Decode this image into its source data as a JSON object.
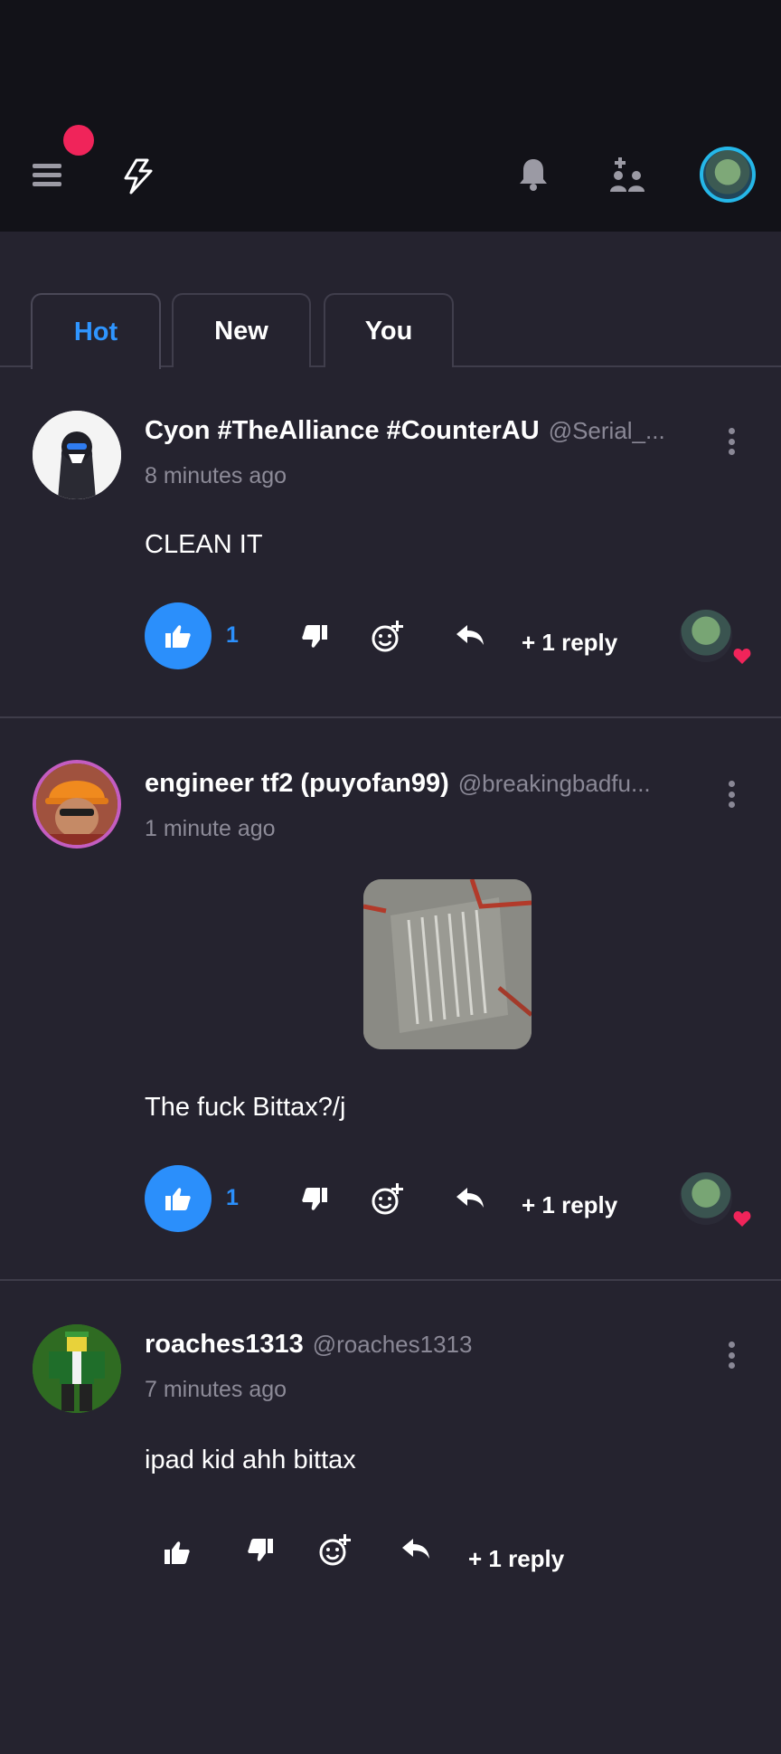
{
  "header": {
    "menu_icon": "hamburger-menu-icon",
    "logo_icon": "lightning-logo-icon",
    "bell_icon": "bell-icon",
    "friends_icon": "friends-add-icon",
    "notification_color": "#f0245a"
  },
  "tabs": [
    {
      "label": "Hot",
      "active": true
    },
    {
      "label": "New",
      "active": false
    },
    {
      "label": "You",
      "active": false
    }
  ],
  "comments": [
    {
      "display_name": "Cyon #TheAlliance #CounterAU",
      "handle": "@Serial_...",
      "time": "8 minutes ago",
      "text": "CLEAN IT",
      "likes": "1",
      "liked": true,
      "replies": "+ 1 reply",
      "has_reactor": true
    },
    {
      "display_name": "engineer tf2 (puyofan99)",
      "handle": "@breakingbadfu...",
      "time": "1 minute ago",
      "text": "The fuck Bittax?/j",
      "likes": "1",
      "liked": true,
      "replies": "+ 1 reply",
      "has_reactor": true,
      "has_image": true
    },
    {
      "display_name": "roaches1313",
      "handle": "@roaches1313",
      "time": "7 minutes ago",
      "text": "ipad kid ahh bittax",
      "likes": "",
      "liked": false,
      "replies": "+ 1 reply",
      "has_reactor": false
    }
  ],
  "colors": {
    "accent": "#2b8ffb",
    "background": "#25232f",
    "topbar": "#121218",
    "heart": "#f0245a"
  }
}
